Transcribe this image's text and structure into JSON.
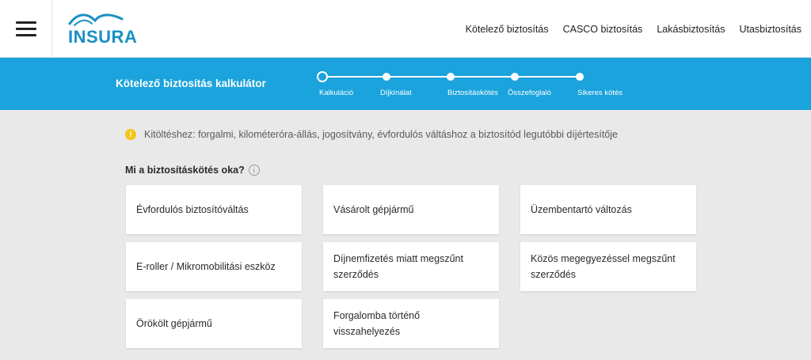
{
  "header": {
    "logo_text": "INSURA",
    "nav": [
      "Kötelező biztosítás",
      "CASCO biztosítás",
      "Lakásbiztosítás",
      "Utasbiztosítás"
    ]
  },
  "banner": {
    "title": "Kötelező biztosítás kalkulátor",
    "steps": [
      "Kalkuláció",
      "Díjkínálat",
      "Biztosításkötés",
      "Összefoglaló",
      "Sikeres kötés"
    ],
    "current_step": 1
  },
  "hint": {
    "icon": "!",
    "text": "Kitöltéshez: forgalmi, kilométeróra-állás, jogosítvány, évfordulós váltáshoz a biztosítód legutóbbi díjértesítője"
  },
  "question": {
    "text": "Mi a biztosításkötés oka?",
    "info": "i"
  },
  "options": [
    "Évfordulós biztosítóváltás",
    "Vásárolt gépjármű",
    "Üzembentartó változás",
    "E-roller / Mikromobilitási eszköz",
    "Díjnemfizetés miatt megszűnt szerződés",
    "Közös megegyezéssel megszűnt szerződés",
    "Örökölt gépjármű",
    "Forgalomba történő visszahelyezés"
  ],
  "colors": {
    "banner": "#1aa3dc",
    "logo": "#1a8fc3",
    "hint_icon": "#f5c518",
    "background": "#e9e9e9"
  }
}
